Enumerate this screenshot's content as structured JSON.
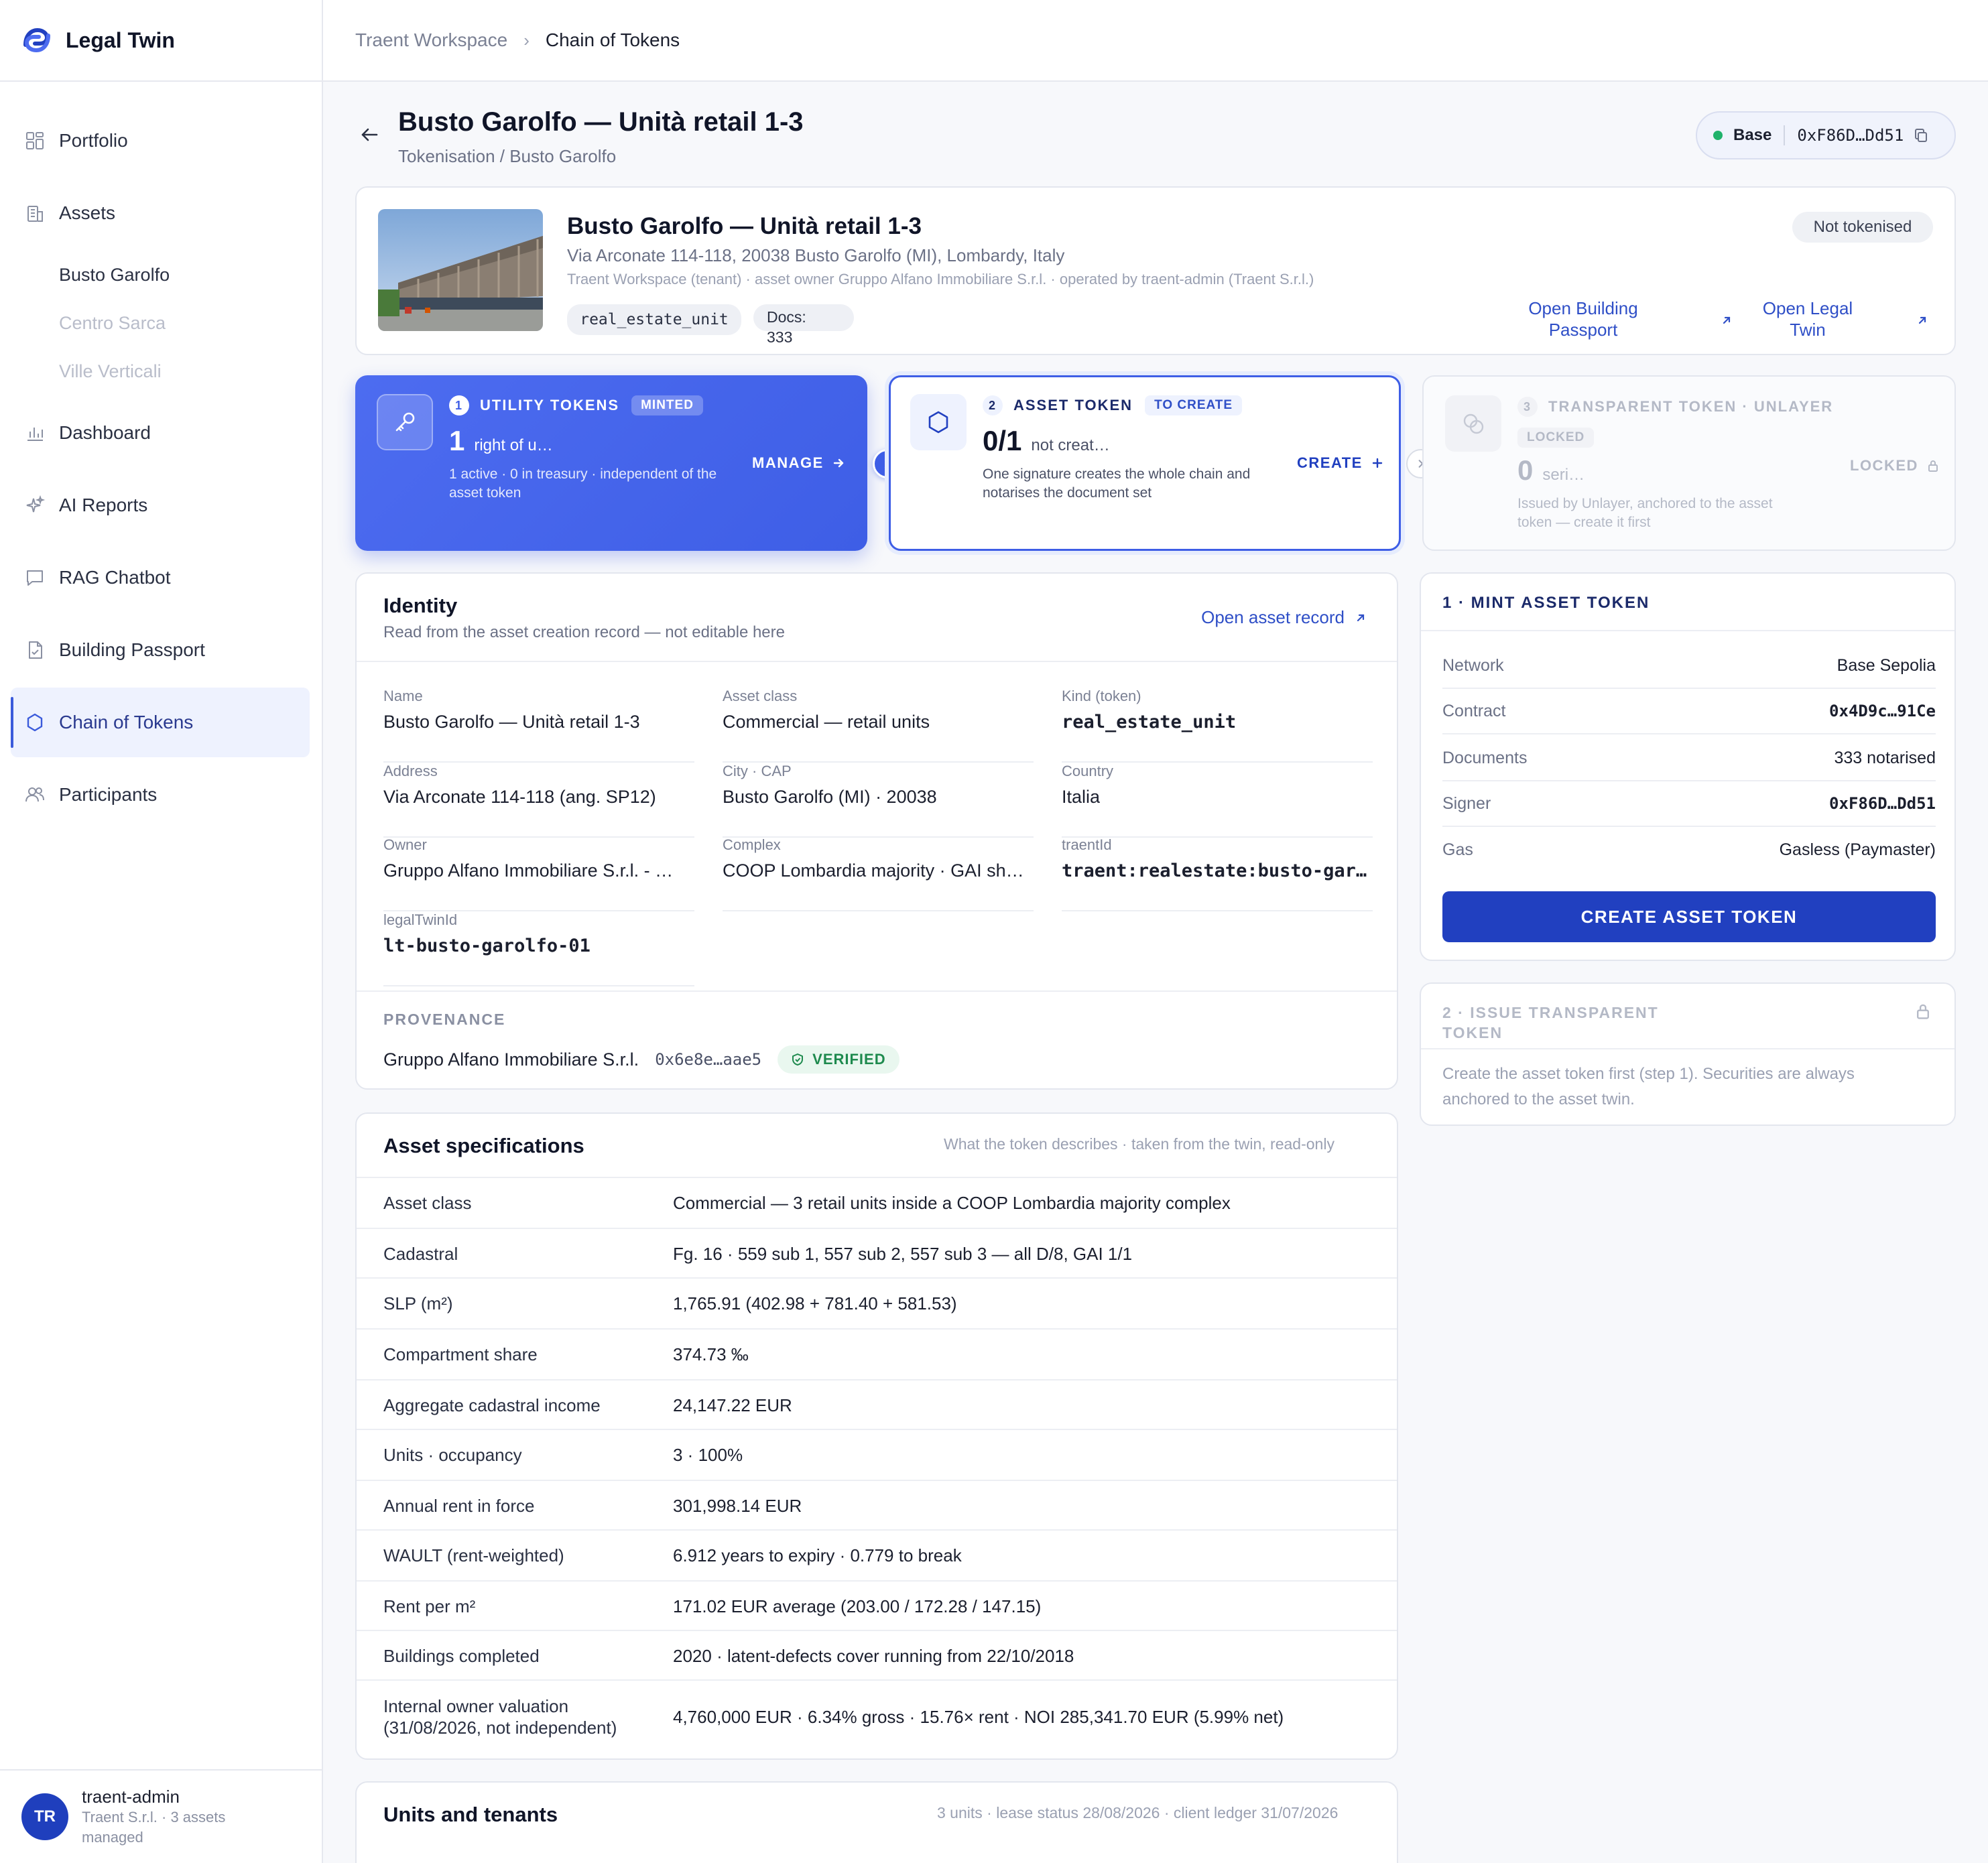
{
  "brand": {
    "name": "Legal Twin"
  },
  "sidebar": {
    "items": [
      {
        "label": "Portfolio"
      },
      {
        "label": "Assets"
      },
      {
        "label": "Dashboard"
      },
      {
        "label": "AI Reports"
      },
      {
        "label": "RAG Chatbot"
      },
      {
        "label": "Building Passport"
      },
      {
        "label": "Chain of Tokens"
      },
      {
        "label": "Participants"
      }
    ],
    "asset_subitems": [
      {
        "label": "Busto Garolfo"
      },
      {
        "label": "Centro Sarca"
      },
      {
        "label": "Ville Verticali"
      }
    ],
    "user": {
      "initials": "TR",
      "name": "traent-admin",
      "sub": "Traent S.r.l. · 3 assets managed"
    }
  },
  "breadcrumb": {
    "workspace": "Traent Workspace",
    "sep": "›",
    "current": "Chain of Tokens"
  },
  "header": {
    "title": "Busto Garolfo — Unità retail 1-3",
    "subtitle": "Tokenisation / Busto Garolfo",
    "network": "Base",
    "wallet": "0xF86D…Dd51"
  },
  "asset": {
    "name": "Busto Garolfo — Unità retail 1-3",
    "address": "Via Arconate 114-118, 20038 Busto Garolfo (MI), Lombardy, Italy",
    "meta": "Traent Workspace (tenant) · asset owner Gruppo Alfano Immobiliare S.r.l. · operated by traent-admin (Traent S.r.l.)",
    "kind_chip": "real_estate_unit",
    "docs_label": "Docs:",
    "docs_count": "333",
    "status": "Not tokenised",
    "link_passport": "Open Building Passport",
    "link_twin": "Open Legal Twin"
  },
  "steps": {
    "s1": {
      "num": "1",
      "title": "UTILITY TOKENS",
      "badge": "MINTED",
      "value": "1",
      "value_label": "right of u…",
      "desc": "1 active · 0 in treasury · independent of the asset token",
      "action": "MANAGE"
    },
    "s2": {
      "num": "2",
      "title": "ASSET TOKEN",
      "badge": "TO CREATE",
      "value": "0/1",
      "value_label": "not creat…",
      "desc": "One signature creates the whole chain and notarises the document set",
      "action": "CREATE"
    },
    "s3": {
      "num": "3",
      "title": "TRANSPARENT TOKEN · UNLAYER",
      "badge": "LOCKED",
      "value": "0",
      "value_label": "seri…",
      "desc": "Issued by Unlayer, anchored to the asset token — create it first",
      "action": "LOCKED"
    }
  },
  "identity": {
    "title": "Identity",
    "subtitle": "Read from the asset creation record — not editable here",
    "link": "Open asset record",
    "fields": [
      {
        "label": "Name",
        "value": "Busto Garolfo — Unità retail 1-3"
      },
      {
        "label": "Asset class",
        "value": "Commercial — retail units"
      },
      {
        "label": "Kind (token)",
        "value": "real_estate_unit"
      },
      {
        "label": "Address",
        "value": "Via Arconate 114-118 (ang. SP12)"
      },
      {
        "label": "City · CAP",
        "value": "Busto Garolfo (MI) · 20038"
      },
      {
        "label": "Country",
        "value": "Italia"
      },
      {
        "label": "Owner",
        "value": "Gruppo Alfano Immobiliare S.r.l. - …"
      },
      {
        "label": "Complex",
        "value": "COOP Lombardia majority · GAI sh…"
      },
      {
        "label": "traentId",
        "value": "traent:realestate:busto-gar…"
      },
      {
        "label": "legalTwinId",
        "value": "lt-busto-garolfo-01"
      }
    ],
    "provenance_label": "PROVENANCE",
    "provenance_owner": "Gruppo Alfano Immobiliare S.r.l.",
    "provenance_hash": "0x6e8e…aae5",
    "verified": "VERIFIED"
  },
  "specs": {
    "title": "Asset specifications",
    "note": "What the token describes · taken from the twin, read-only",
    "rows": [
      {
        "k": "Asset class",
        "v": "Commercial — 3 retail units inside a COOP Lombardia majority complex"
      },
      {
        "k": "Cadastral",
        "v": "Fg. 16 · 559 sub 1, 557 sub 2, 557 sub 3 — all D/8, GAI 1/1"
      },
      {
        "k": "SLP (m²)",
        "v": "1,765.91 (402.98 + 781.40 + 581.53)"
      },
      {
        "k": "Compartment share",
        "v": "374.73 ‰"
      },
      {
        "k": "Aggregate cadastral income",
        "v": "24,147.22 EUR"
      },
      {
        "k": "Units · occupancy",
        "v": "3 · 100%"
      },
      {
        "k": "Annual rent in force",
        "v": "301,998.14 EUR"
      },
      {
        "k": "WAULT (rent-weighted)",
        "v": "6.912 years to expiry · 0.779 to break"
      },
      {
        "k": "Rent per m²",
        "v": "171.02 EUR average (203.00 / 172.28 / 147.15)"
      },
      {
        "k": "Buildings completed",
        "v": "2020 · latent-defects cover running from 22/10/2018"
      },
      {
        "k": "Internal owner valuation (31/08/2026, not independent)",
        "v": "4,760,000 EUR · 6.34% gross · 15.76× rent · NOI 285,341.70 EUR (5.99% net)"
      }
    ]
  },
  "units": {
    "title": "Units and tenants",
    "note": "3 units · lease status 28/08/2026 · client ledger 31/07/2026"
  },
  "mint": {
    "title": "1 · MINT ASSET TOKEN",
    "rows": [
      {
        "k": "Network",
        "v": "Base Sepolia"
      },
      {
        "k": "Contract",
        "v": "0x4D9c…91Ce"
      },
      {
        "k": "Documents",
        "v": "333 notarised"
      },
      {
        "k": "Signer",
        "v": "0xF86D…Dd51"
      },
      {
        "k": "Gas",
        "v": "Gasless (Paymaster)"
      }
    ],
    "button": "CREATE ASSET TOKEN"
  },
  "issue": {
    "title": "2 · ISSUE TRANSPARENT TOKEN",
    "desc": "Create the asset token first (step 1). Securities are always anchored to the asset twin."
  },
  "colors": {
    "accent": "#3e5ee6",
    "primary_button": "#2140c0",
    "verified": "#1e8a4e"
  }
}
